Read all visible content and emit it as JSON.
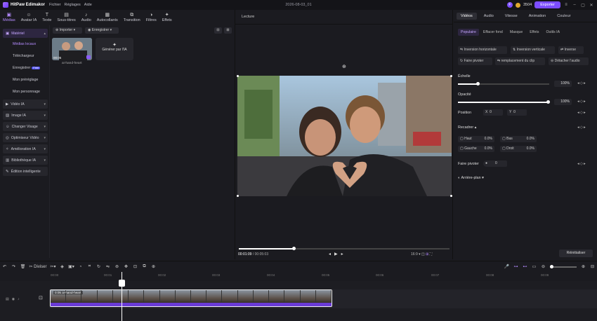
{
  "titlebar": {
    "app_name": "HitPaw Edimakor",
    "menus": [
      "Fichier",
      "Réglages",
      "Aide"
    ],
    "project_name": "2026-08-03_01",
    "avatar_letter": "F",
    "credits": "3504",
    "export_label": "Exporter"
  },
  "top_tabs": [
    {
      "label": "Médias",
      "icon": "folder-icon"
    },
    {
      "label": "Avatar IA",
      "icon": "avatar-icon"
    },
    {
      "label": "Texte",
      "icon": "text-icon"
    },
    {
      "label": "Sous-titres",
      "icon": "subtitles-icon"
    },
    {
      "label": "Audio",
      "icon": "music-icon"
    },
    {
      "label": "Autocollants",
      "icon": "sticker-icon"
    },
    {
      "label": "Transition",
      "icon": "transition-icon"
    },
    {
      "label": "Filtres",
      "icon": "filter-icon"
    },
    {
      "label": "Effets",
      "icon": "effects-icon"
    }
  ],
  "left_nav": {
    "material_group": "Matériel",
    "items": [
      "Médias locaux",
      "Téléchargeur",
      "Enregistrer",
      "Mon préréglage",
      "Mon personnage"
    ],
    "free_badge": "Free",
    "groups": [
      "Vidéo IA",
      "Image IA",
      "Changer Visage",
      "Optimiseur Vidéo",
      "Amélioration IA",
      "Bibliothèque IA",
      "Édition intelligente"
    ]
  },
  "media": {
    "import_label": "Importer",
    "record_label": "Enregistrer",
    "thumb_duration": "00:05",
    "thumb_name": "ai-hand-heart",
    "generate_label": "Générer par l'IA"
  },
  "preview": {
    "title": "Lecture",
    "time_current": "00:01:09",
    "time_total": "00:05:03",
    "ratio": "16:9",
    "progress": 0.26
  },
  "right_panel": {
    "tabs": [
      "Vidéos",
      "Audio",
      "Vitesse",
      "Animation",
      "Couleur"
    ],
    "subtabs": [
      "Populaire",
      "Effacer fond",
      "Masque",
      "Effets",
      "Outils IA"
    ],
    "buttons_row1": [
      "Inversion horizontale",
      "Inversion verticale",
      "Inverse"
    ],
    "buttons_row2": [
      "Faire pivoter",
      "remplacement du clip",
      "Détacher l'audio"
    ],
    "scale_label": "Échelle",
    "scale_value": "100%",
    "opacity_label": "Opacité",
    "opacity_value": "100%",
    "position_label": "Position",
    "pos_x_label": "X",
    "pos_x": "0",
    "pos_y_label": "Y",
    "pos_y": "0",
    "crop_label": "Recadrer",
    "crop_fields": [
      {
        "label": "Haut",
        "value": "0.0%"
      },
      {
        "label": "Bas",
        "value": "0.0%"
      },
      {
        "label": "Gauche",
        "value": "0.0%"
      },
      {
        "label": "Droit",
        "value": "0.0%"
      }
    ],
    "rotate_label": "Faire pivoter",
    "rotate_value": "0",
    "background_label": "Arrière-plan",
    "reset_label": "Réinitialiser"
  },
  "timeline": {
    "split_label": "Diviser",
    "ruler_ticks": [
      "00:00",
      "00:01",
      "00:02",
      "00:03",
      "00:04",
      "00:05",
      "00:06",
      "00:07",
      "00:08",
      "00:09"
    ],
    "clip_label": "0:05 ai-hand-heart"
  },
  "colors": {
    "accent": "#7c4dff",
    "bg": "#1b1b20",
    "clip_bar": "#6a3bd6"
  }
}
